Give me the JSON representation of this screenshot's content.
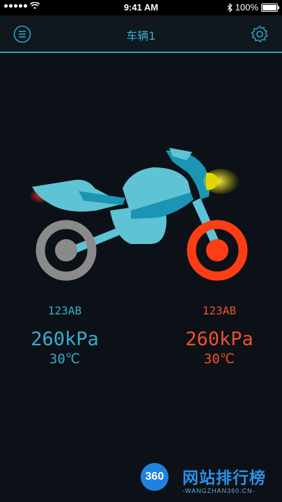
{
  "status_bar": {
    "time": "9:41 AM",
    "battery": "100%",
    "icons": [
      "signal-icon",
      "wifi-icon",
      "bluetooth-icon",
      "battery-icon"
    ]
  },
  "nav": {
    "title": "车辆1",
    "left_icon": "menu-icon",
    "right_icon": "gear-icon"
  },
  "tires": {
    "rear": {
      "id": "123AB",
      "pressure": "260kPa",
      "temperature": "30℃",
      "color": "#36aed0"
    },
    "front": {
      "id": "123AB",
      "pressure": "260kPa",
      "temperature": "30℃",
      "color": "#f2502a"
    }
  },
  "colors": {
    "accent": "#2aa6c8",
    "bike_body": "#5fc3d6",
    "bike_dark": "#1a95b3",
    "rear_wheel": "#8a8a8a",
    "front_wheel": "#ff3d14",
    "headlight": "#e2d800",
    "taillight": "#e0202a"
  },
  "watermark": {
    "logo_text": "360",
    "title": "网站排行榜",
    "subtitle": "-WANGZHAN360.CN-"
  }
}
